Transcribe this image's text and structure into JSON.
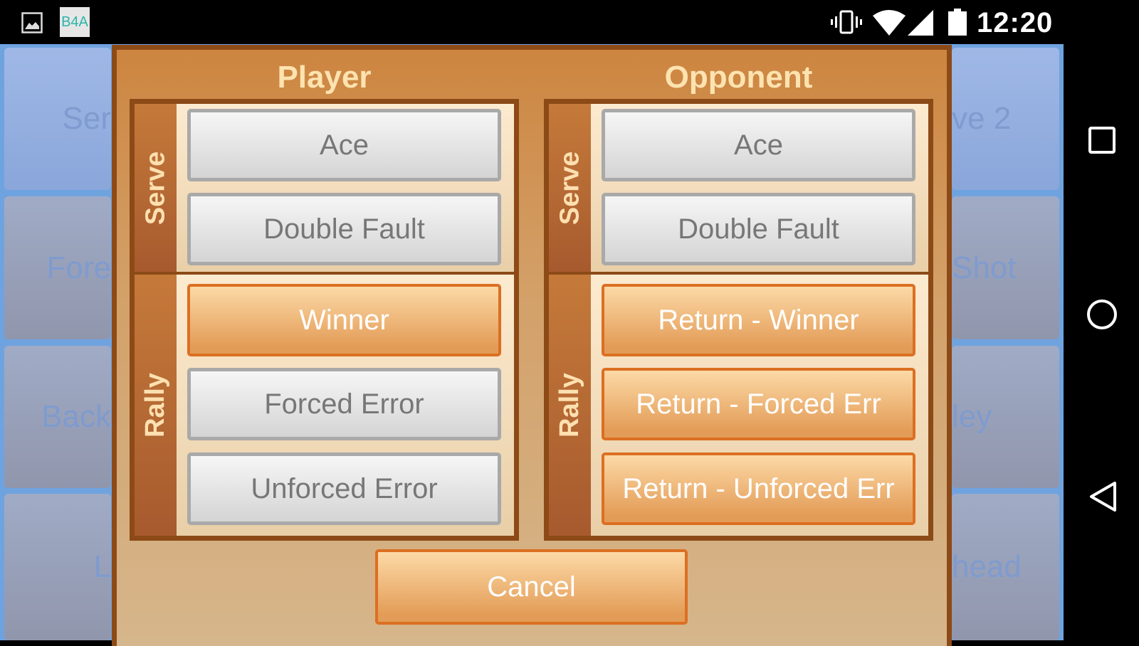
{
  "status_bar": {
    "time": "12:20",
    "app_badge": "B4A",
    "icons": [
      "image-icon",
      "b4a-app-icon",
      "vibrate-icon",
      "wifi-icon",
      "signal-icon",
      "battery-icon"
    ]
  },
  "nav_bar": {
    "icons": [
      "recents-square-icon",
      "home-circle-icon",
      "back-triangle-icon"
    ]
  },
  "background_tiles": {
    "left": [
      "Ser",
      "Fore",
      "Back",
      "L"
    ],
    "right": [
      "ve 2",
      "Shot",
      "ley",
      "head"
    ]
  },
  "dialog": {
    "player": {
      "title": "Player",
      "serve_label": "Serve",
      "rally_label": "Rally",
      "serve_buttons": [
        "Ace",
        "Double Fault"
      ],
      "rally_buttons": [
        "Winner",
        "Forced Error",
        "Unforced Error"
      ]
    },
    "opponent": {
      "title": "Opponent",
      "serve_label": "Serve",
      "rally_label": "Rally",
      "serve_buttons": [
        "Ace",
        "Double Fault"
      ],
      "rally_buttons": [
        "Return - Winner",
        "Return - Forced Err",
        "Return - Unforced Err"
      ]
    },
    "cancel_label": "Cancel"
  },
  "colors": {
    "dialog_border": "#8c4a17",
    "title": "#fde3b0",
    "orange_button_border": "#dc6f22",
    "background_blue": "#6fa3e0"
  }
}
